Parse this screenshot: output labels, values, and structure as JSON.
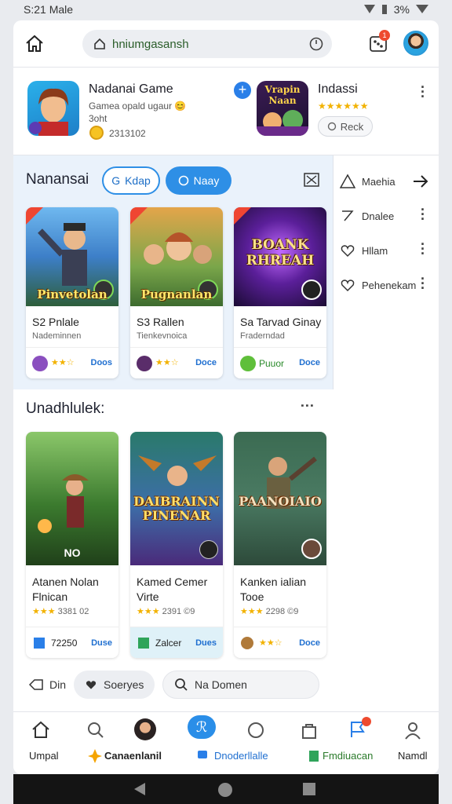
{
  "status": {
    "time": "S:21 Male",
    "battery": "3%"
  },
  "topbar": {
    "url": "hniumgasansh"
  },
  "featured": [
    {
      "title": "Nadanai Game",
      "subtitle": "Gamea opald ugaur 😊",
      "subtitle2": "3oht",
      "count": "2313102"
    },
    {
      "title": "Indassi",
      "icon_text": "Vrapin Naan",
      "stars": "★★★★★★",
      "button": "Reck"
    }
  ],
  "section1": {
    "title": "Nanansai",
    "pill_outline": "Kdap",
    "pill_fill": "Naay",
    "cards": [
      {
        "art": "Pinvetolan",
        "name": "S2 Pnlale",
        "sub": "Nademinnen",
        "stars": "★★☆",
        "action": "Doos"
      },
      {
        "art": "Pugnanlan",
        "name": "S3 Rallen",
        "sub": "Tienkevnoica",
        "stars": "★★☆",
        "action": "Doce"
      },
      {
        "art": "BOANK RHREAH",
        "name": "Sa Tarvad Ginay",
        "sub": "Fraderndad",
        "label": "Puuor",
        "action": "Doce"
      }
    ]
  },
  "side": [
    {
      "label": "Maehia"
    },
    {
      "label": "Dnalee"
    },
    {
      "label": "Hllam"
    },
    {
      "label": "Pehenekam"
    }
  ],
  "section2": {
    "title": "Unadhlulek:",
    "cards": [
      {
        "art": "NO",
        "name": "Atanen Nolan Flnican",
        "stars": "★★★",
        "count": "3381 02",
        "label": "72250",
        "action": "Duse"
      },
      {
        "art": "DAIBRAINN PINENAR",
        "name": "Kamed Cemer Virte",
        "stars": "★★★",
        "count": "2391 ©9",
        "label": "Zalcer",
        "action": "Dues"
      },
      {
        "art": "PAANOIAIO",
        "name": "Kanken ialian Tooe",
        "stars": "★★★",
        "count": "2298 ©9",
        "label": "",
        "action": "Doce"
      }
    ]
  },
  "chips": [
    {
      "label": "Din"
    },
    {
      "label": "Soeryes"
    },
    {
      "label": "Na Domen"
    }
  ],
  "nav": [
    {
      "label": "Umpal",
      "color": "#444444"
    },
    {
      "label": "",
      "color": "#444444"
    },
    {
      "label": "Canaenlanil",
      "color": "#222222"
    },
    {
      "label": "Dnoderllalle",
      "color": "#1f6fd0"
    },
    {
      "label": "",
      "color": "#444444"
    },
    {
      "label": "",
      "color": "#444444"
    },
    {
      "label": "Fmdiuacan",
      "color": "#2a7a2a"
    },
    {
      "label": "Namdl",
      "color": "#444444"
    }
  ]
}
